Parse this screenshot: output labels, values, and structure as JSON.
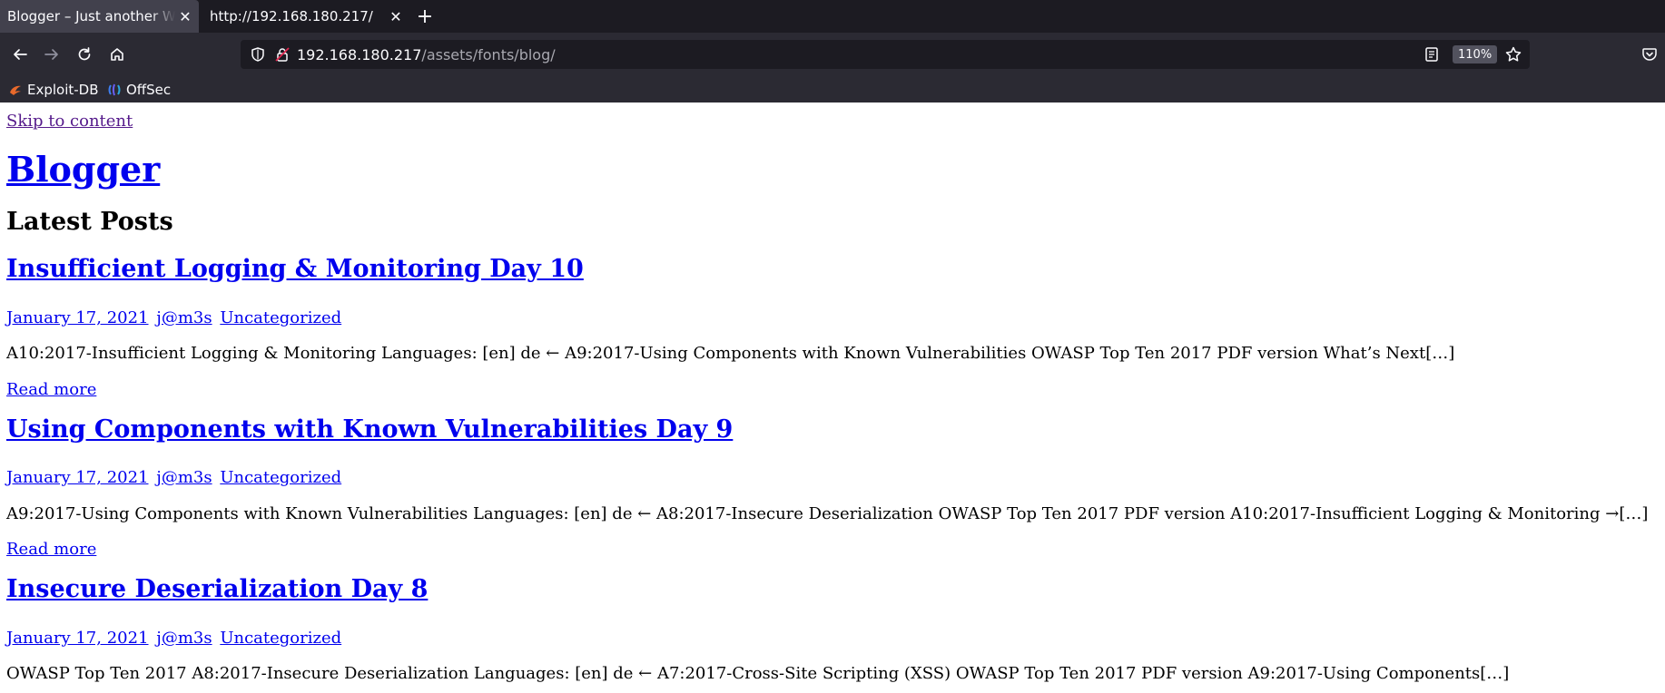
{
  "browser": {
    "tabs": [
      {
        "title": "Blogger – Just another WordPress site",
        "active": true
      },
      {
        "title": "http://192.168.180.217/",
        "active": false
      }
    ],
    "url_host": "192.168.180.217",
    "url_path": "/assets/fonts/blog/",
    "zoom": "110%",
    "bookmarks": [
      {
        "label": "Exploit-DB",
        "icon": "exploitdb-icon"
      },
      {
        "label": "OffSec",
        "icon": "offsec-icon"
      }
    ],
    "colors": {
      "tabbar": "#1c1b22",
      "toolbar": "#2b2a33",
      "urlfield": "#1c1b22",
      "active_tab": "#42414d"
    }
  },
  "page": {
    "skip_link": "Skip to content",
    "site_title": "Blogger",
    "section_heading": "Latest Posts",
    "posts": [
      {
        "title": "Insufficient Logging & Monitoring Day 10",
        "date": "January 17, 2021",
        "author": "j@m3s",
        "category": "Uncategorized",
        "excerpt": "A10:2017-Insufficient Logging & Monitoring Languages: [en] de ← A9:2017-Using Components with Known Vulnerabilities OWASP Top Ten 2017 PDF version What’s Next[…]",
        "read_more": "Read more"
      },
      {
        "title": "Using Components with Known Vulnerabilities Day 9",
        "date": "January 17, 2021",
        "author": "j@m3s",
        "category": "Uncategorized",
        "excerpt": "A9:2017-Using Components with Known Vulnerabilities Languages: [en] de ← A8:2017-Insecure Deserialization OWASP Top Ten 2017 PDF version A10:2017-Insufficient Logging & Monitoring →[…]",
        "read_more": "Read more"
      },
      {
        "title": "Insecure Deserialization Day 8",
        "date": "January 17, 2021",
        "author": "j@m3s",
        "category": "Uncategorized",
        "excerpt": "OWASP Top Ten 2017 A8:2017-Insecure Deserialization Languages: [en] de ← A7:2017-Cross-Site Scripting (XSS) OWASP Top Ten 2017 PDF version A9:2017-Using Components[…]"
      }
    ],
    "colors": {
      "link": "#0000ee",
      "visited_link": "#551a8b"
    }
  }
}
